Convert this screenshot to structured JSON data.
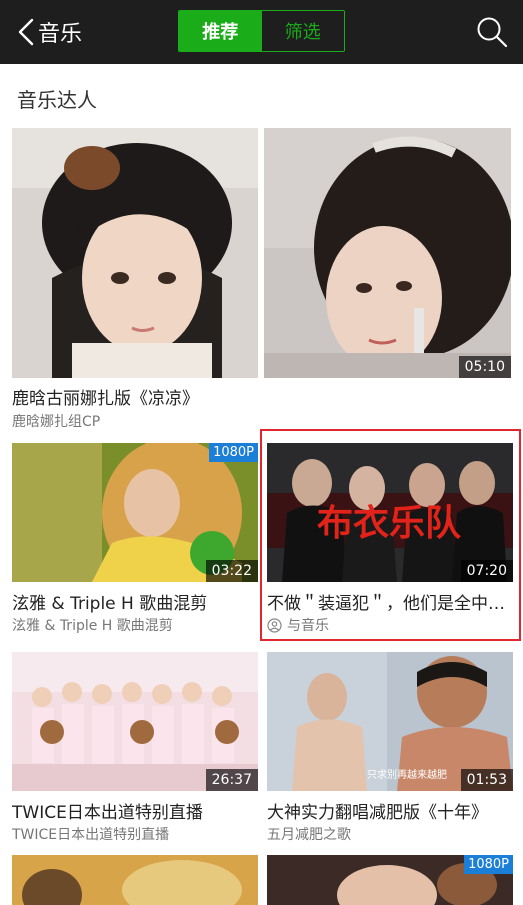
{
  "topbar": {
    "back_label": "音乐",
    "tabs": [
      {
        "label": "推荐",
        "active": true
      },
      {
        "label": "筛选",
        "active": false
      }
    ],
    "accent": "#1aad19"
  },
  "section": {
    "title": "音乐达人"
  },
  "cards": [
    {
      "title": "鹿晗古丽娜扎版《凉凉》",
      "sub": "鹿晗娜扎组CP",
      "duration": "05:10"
    },
    {
      "title": "泫雅 & Triple H 歌曲混剪",
      "sub": "泫雅 & Triple H 歌曲混剪",
      "duration": "03:22",
      "badge": "1080P"
    },
    {
      "title": "不做＂装逼犯＂，他们是全中国最真实的乐队",
      "sub": "与音乐",
      "duration": "07:20",
      "poster_text": "布衣乐队"
    },
    {
      "title": "TWICE日本出道特别直播",
      "sub": "TWICE日本出道特别直播",
      "duration": "26:37"
    },
    {
      "title": "大神实力翻唱减肥版《十年》",
      "sub": "五月减肥之歌",
      "duration": "01:53",
      "caption": "只求别再越来越肥"
    },
    {
      "title": "",
      "sub": "",
      "duration": ""
    },
    {
      "title": "",
      "sub": "",
      "duration": "",
      "badge": "1080P"
    }
  ]
}
